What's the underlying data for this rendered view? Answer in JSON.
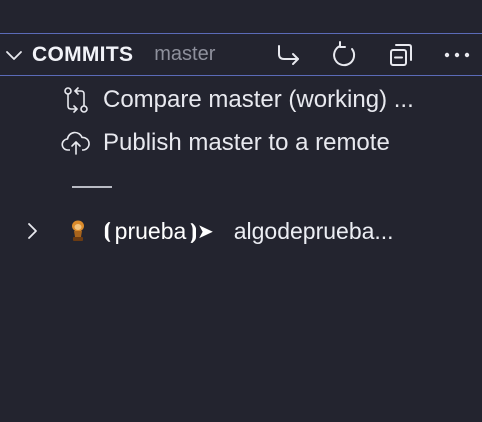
{
  "header": {
    "title": "COMMITS",
    "branch": "master",
    "actions": [
      "go-to-file-icon",
      "refresh-icon",
      "collapse-all-icon",
      "more-icon"
    ]
  },
  "items": {
    "compare": {
      "label": "Compare master (working) ...",
      "icon": "compare-icon"
    },
    "publish": {
      "label": "Publish master to a remote",
      "icon": "cloud-upload-icon"
    }
  },
  "commit": {
    "tag_open": "⦗",
    "tag": "prueba",
    "tag_close": "⦘➤",
    "message": "algodeprueba..."
  },
  "colors": {
    "background": "#23242f",
    "border_accent": "#5b6bb8",
    "muted_text": "#8e909c",
    "text": "#e8e9ef"
  }
}
